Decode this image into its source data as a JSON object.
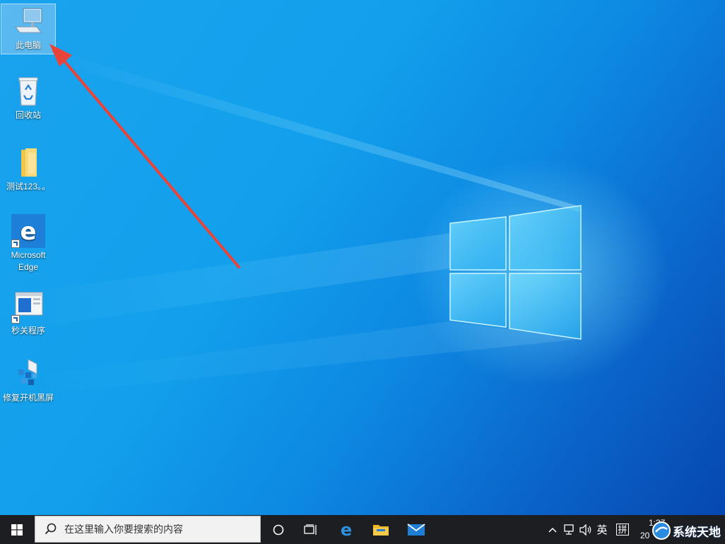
{
  "desktop": {
    "icons": [
      {
        "label": "此电脑"
      },
      {
        "label": "回收站"
      },
      {
        "label": "测试123。。"
      },
      {
        "label_line1": "Microsoft",
        "label_line2": "Edge"
      },
      {
        "label": "秒关程序"
      },
      {
        "label": "修复开机黑屏"
      }
    ]
  },
  "taskbar": {
    "start_icon": "windows-logo-icon",
    "search_placeholder": "在这里输入你要搜索的内容",
    "apps": [
      "cortana-icon",
      "task-view-icon",
      "edge-icon",
      "file-explorer-icon",
      "mail-icon"
    ],
    "tray": {
      "ime_language": "英",
      "ime_mode": "拼",
      "time_partial": "1:37",
      "date_partial": "20"
    }
  },
  "watermark": {
    "text": "系统天地"
  },
  "colors": {
    "taskbar": "#1c1e22",
    "annotation_arrow": "#e8443a",
    "accent": "#0078d7"
  }
}
